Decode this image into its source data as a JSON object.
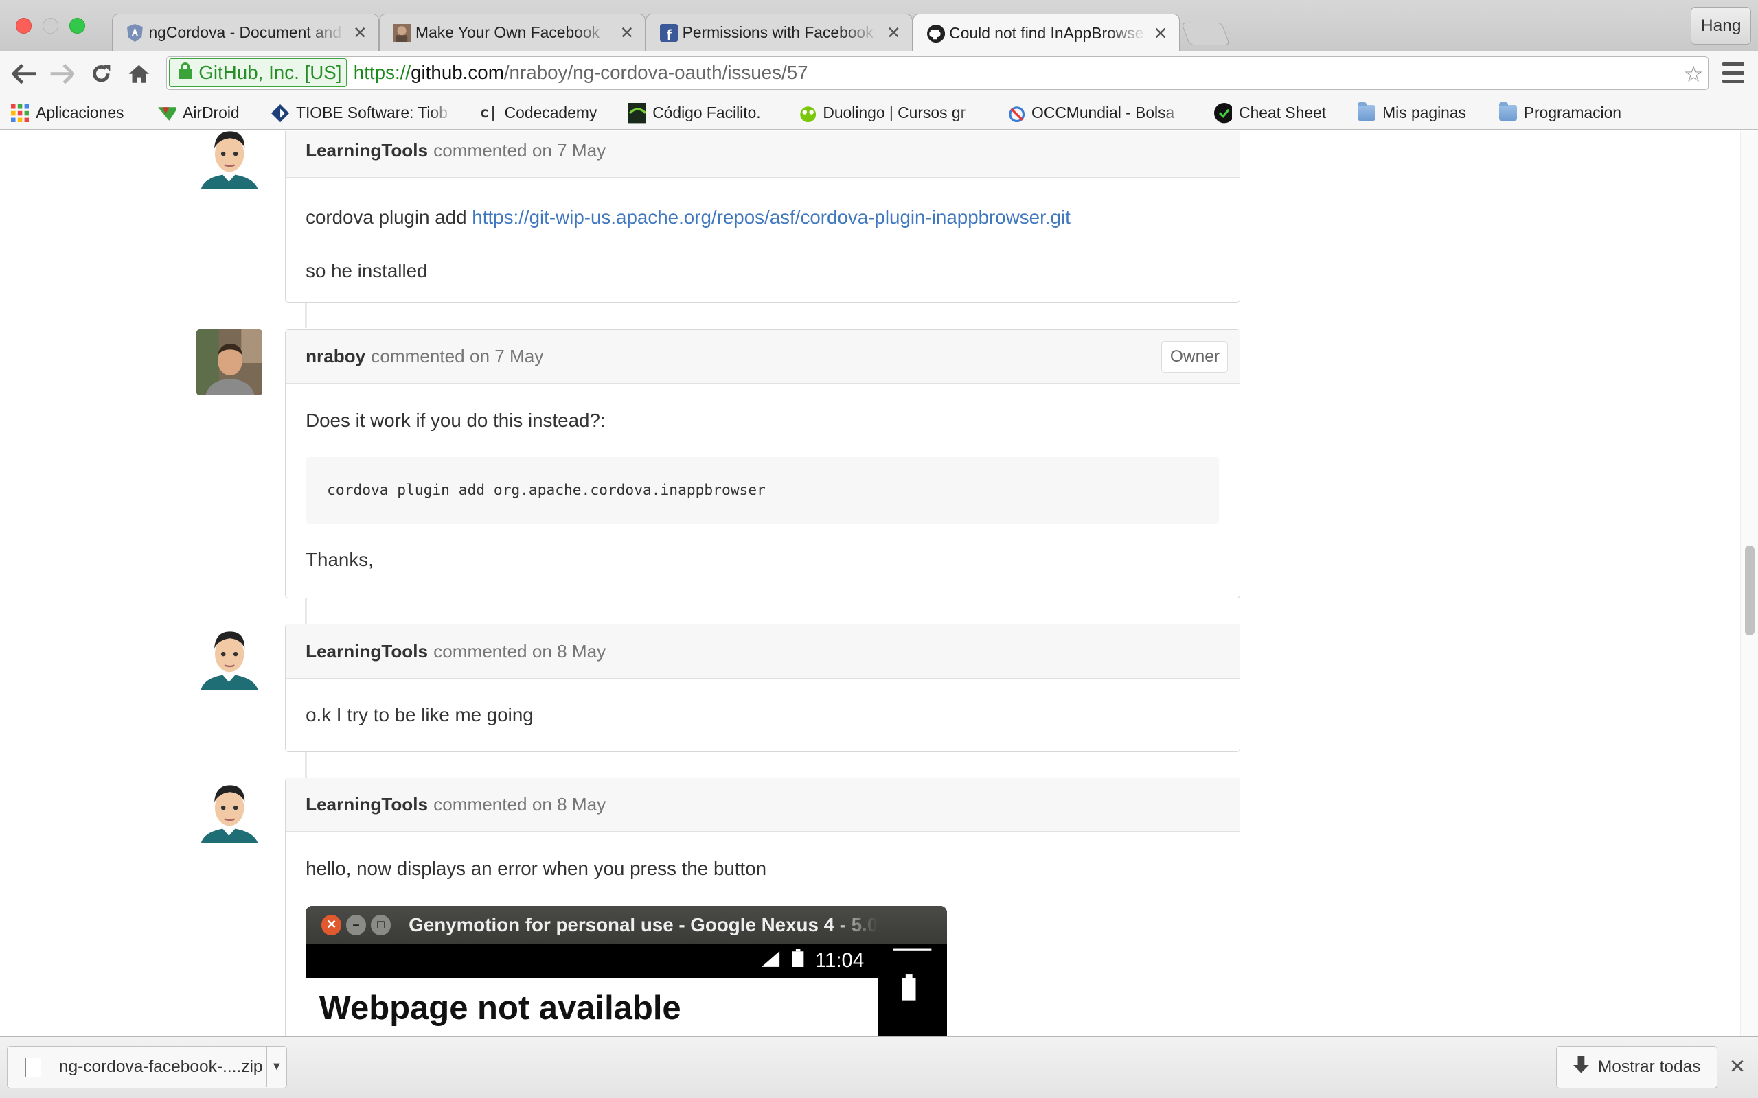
{
  "window": {
    "user_button": "Hang"
  },
  "tabs": [
    {
      "title": "ngCordova - Document and",
      "favicon": "angular-shield-icon",
      "active": false
    },
    {
      "title": "Make Your Own Facebook",
      "favicon": "photo-icon",
      "active": false
    },
    {
      "title": "Permissions with Facebook",
      "favicon": "facebook-icon",
      "active": false
    },
    {
      "title": "Could not find InAppBrowse",
      "favicon": "github-icon",
      "active": true
    }
  ],
  "omnibox": {
    "ev_label": "GitHub, Inc. [US]",
    "scheme": "https://",
    "host": "github.com",
    "path": "/nraboy/ng-cordova-oauth/issues/57"
  },
  "bookmarks": [
    {
      "label": "Aplicaciones",
      "icon": "apps-grid-icon"
    },
    {
      "label": "AirDroid",
      "icon": "airdroid-icon"
    },
    {
      "label": "TIOBE Software: Tiob",
      "icon": "tiobe-icon"
    },
    {
      "label": "Codecademy",
      "icon": "codecademy-icon"
    },
    {
      "label": "Código Facilito.",
      "icon": "facilito-icon"
    },
    {
      "label": "Duolingo | Cursos gr",
      "icon": "duolingo-icon"
    },
    {
      "label": "OCCMundial - Bolsa",
      "icon": "occ-icon"
    },
    {
      "label": "Cheat Sheet",
      "icon": "cheatsheet-icon"
    },
    {
      "label": "Mis paginas",
      "icon": "folder-icon"
    },
    {
      "label": "Programacion",
      "icon": "folder-icon"
    }
  ],
  "comments": [
    {
      "author": "LearningTools",
      "meta": "commented on 7 May",
      "lines": [
        "cordova plugin add ",
        "so he installed"
      ],
      "link": "https://git-wip-us.apache.org/repos/asf/cordova-plugin-inappbrowser.git"
    },
    {
      "author": "nraboy",
      "meta": "commented on 7 May",
      "badge": "Owner",
      "intro": "Does it work if you do this instead?:",
      "code": "cordova plugin add org.apache.cordova.inappbrowser",
      "outro": "Thanks,"
    },
    {
      "author": "LearningTools",
      "meta": "commented on 8 May",
      "text": "o.k I try to be like me going"
    },
    {
      "author": "LearningTools",
      "meta": "commented on 8 May",
      "text": "hello, now displays an error when you press the button",
      "screenshot": {
        "window_title": "Genymotion for personal use - Google Nexus 4 - 5.0",
        "clock": "11:04",
        "page_heading": "Webpage not available"
      }
    }
  ],
  "downloads": {
    "file": "ng-cordova-facebook-....zip",
    "show_all": "Mostrar todas"
  }
}
